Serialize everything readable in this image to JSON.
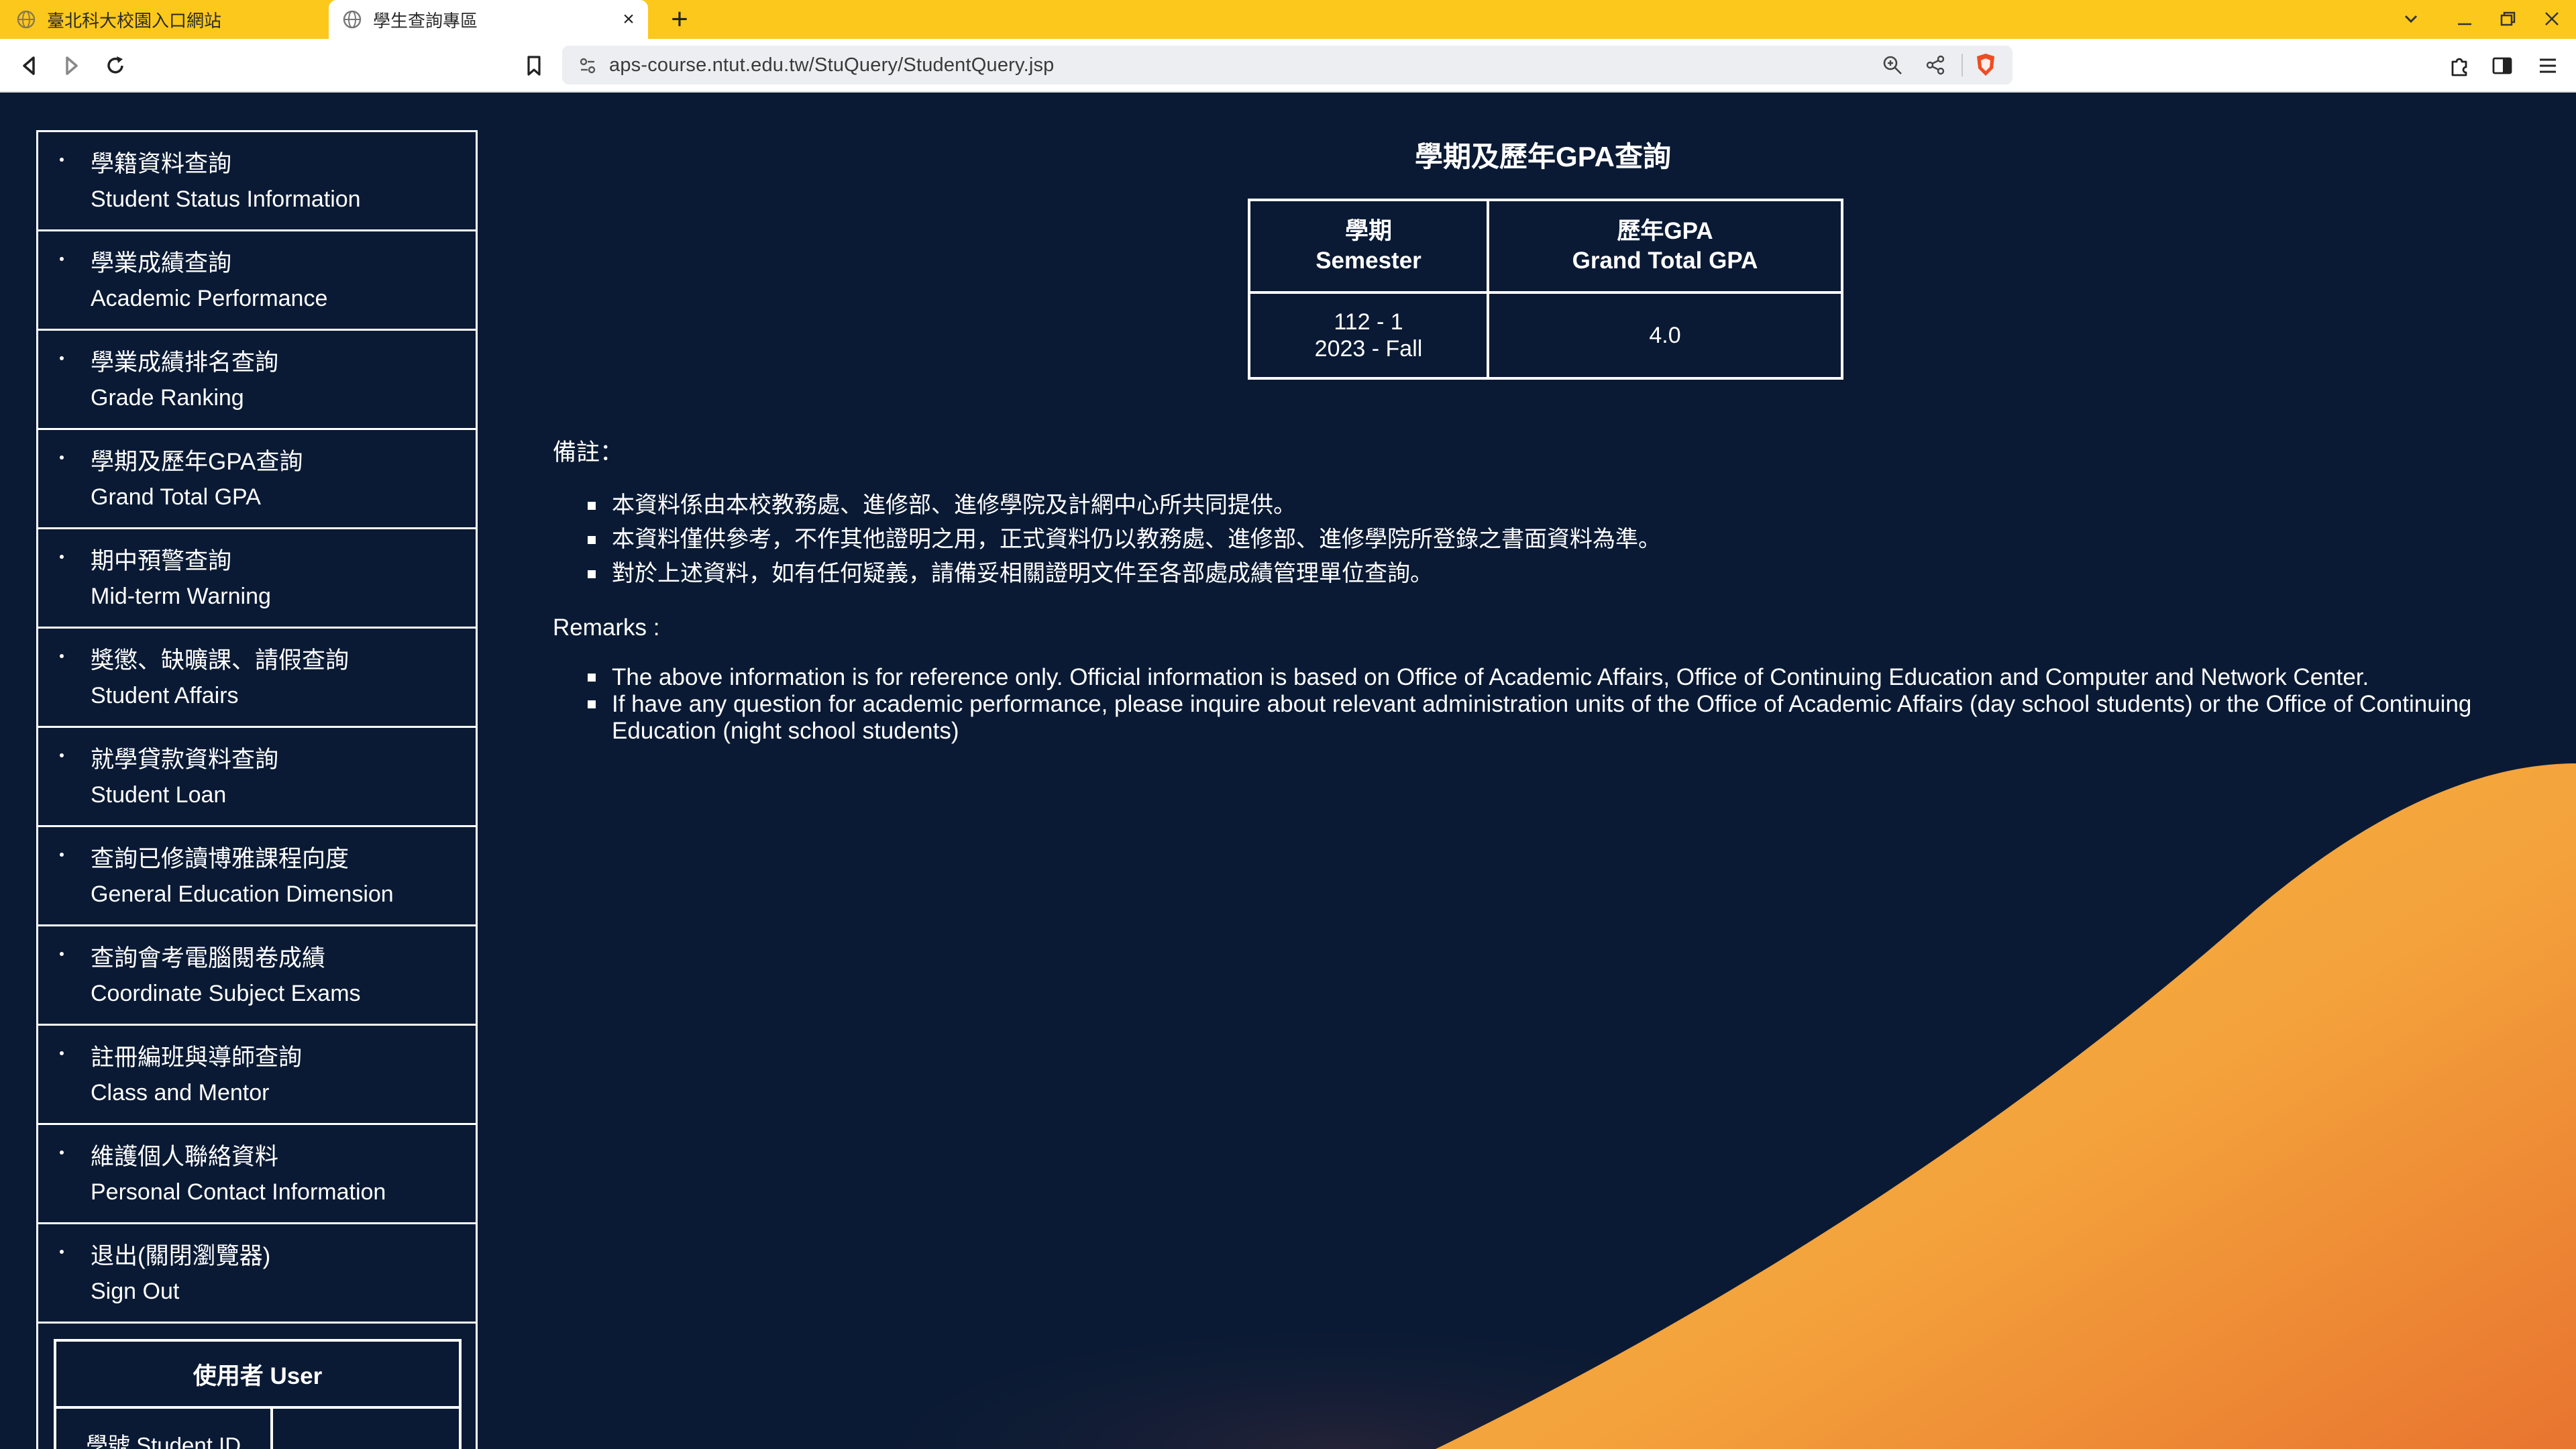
{
  "browser": {
    "tabs": [
      {
        "title": "臺北科大校園入口網站",
        "active": false
      },
      {
        "title": "學生查詢專區",
        "active": true
      }
    ],
    "url": "aps-course.ntut.edu.tw/StuQuery/StudentQuery.jsp",
    "tab_bar_color": "#fdc81c"
  },
  "sidebar": {
    "items": [
      {
        "zh": "學籍資料查詢",
        "en": "Student Status Information"
      },
      {
        "zh": "學業成績查詢",
        "en": "Academic Performance"
      },
      {
        "zh": "學業成績排名查詢",
        "en": "Grade Ranking"
      },
      {
        "zh": "學期及歷年GPA查詢",
        "en": "Grand Total GPA"
      },
      {
        "zh": "期中預警查詢",
        "en": "Mid-term Warning"
      },
      {
        "zh": "獎懲、缺曠課、請假查詢",
        "en": "Student Affairs"
      },
      {
        "zh": "就學貸款資料查詢",
        "en": "Student Loan"
      },
      {
        "zh": "查詢已修讀博雅課程向度",
        "en": "General Education Dimension"
      },
      {
        "zh": "查詢會考電腦閱卷成績",
        "en": "Coordinate Subject Exams"
      },
      {
        "zh": "註冊編班與導師查詢",
        "en": "Class and Mentor"
      },
      {
        "zh": "維護個人聯絡資料",
        "en": "Personal Contact Information"
      },
      {
        "zh": "退出(關閉瀏覽器)",
        "en": "Sign Out"
      }
    ]
  },
  "user_box": {
    "title": "使用者 User",
    "student_id_label": "學號 Student ID"
  },
  "main": {
    "title": "學期及歷年GPA查詢",
    "table": {
      "header": [
        {
          "zh": "學期",
          "en": "Semester"
        },
        {
          "zh": "歷年GPA",
          "en": "Grand Total GPA"
        }
      ],
      "rows": [
        {
          "semester_code": "112 - 1",
          "semester_name": "2023 - Fall",
          "gpa": "4.0"
        }
      ]
    },
    "remarks_zh_title": "備註：",
    "remarks_zh": [
      "本資料係由本校教務處、進修部、進修學院及計網中心所共同提供。",
      "本資料僅供參考，不作其他證明之用，正式資料仍以教務處、進修部、進修學院所登錄之書面資料為準。",
      "對於上述資料，如有任何疑義，請備妥相關證明文件至各部處成績管理單位查詢。"
    ],
    "remarks_en_title": "Remarks :",
    "remarks_en": [
      "The above information is for reference only. Official information is based on Office of Academic Affairs, Office of Continuing Education and Computer and Network Center.",
      "If have any question for academic performance, please inquire about relevant administration units of the Office of Academic Affairs (day school students) or the Office of Continuing Education (night school students)"
    ]
  },
  "colors": {
    "page_background": "#0a1a34",
    "wave_orange": "#f5a53a",
    "text": "#ffffff"
  }
}
